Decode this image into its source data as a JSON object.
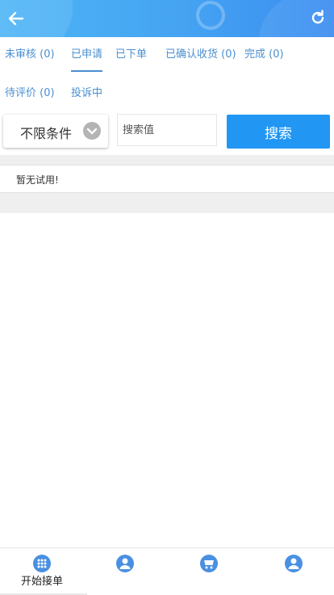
{
  "tabs": [
    {
      "label": "未审核 (0)",
      "active": false
    },
    {
      "label": "已申请",
      "active": true
    },
    {
      "label": "已下单",
      "active": false
    },
    {
      "label": "已确认收货 (0)",
      "active": false
    },
    {
      "label": "完成 (0)",
      "active": false
    },
    {
      "label": "待评价 (0)",
      "active": false
    },
    {
      "label": "投诉中",
      "active": false
    }
  ],
  "filter": {
    "label": "不限条件"
  },
  "search": {
    "placeholder": "搜索值",
    "value": "",
    "button_label": "搜索"
  },
  "list": {
    "empty_message": "暂无试用!"
  },
  "bottom_nav": {
    "items": [
      {
        "label": "开始接单",
        "icon": "grid-icon"
      },
      {
        "label": "",
        "icon": "user-group-icon"
      },
      {
        "label": "",
        "icon": "cart-icon"
      },
      {
        "label": "",
        "icon": "user-icon"
      }
    ]
  },
  "colors": {
    "header": "#45a3f2",
    "accent": "#2196f3",
    "tab_text": "#4a8fd0"
  }
}
